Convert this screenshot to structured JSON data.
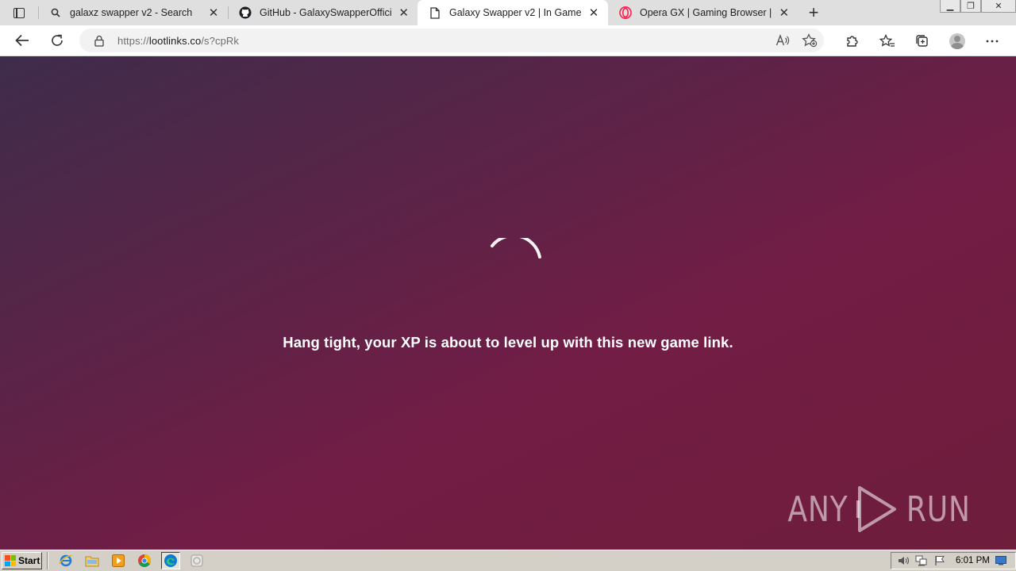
{
  "browser": {
    "tabs": [
      {
        "title": "galaxz swapper v2 - Search",
        "icon": "search-icon",
        "active": false
      },
      {
        "title": "GitHub - GalaxySwapperOfficial/",
        "icon": "github-icon",
        "active": false
      },
      {
        "title": "Galaxy Swapper v2 | In Game",
        "icon": "page-icon",
        "active": true
      },
      {
        "title": "Opera GX | Gaming Browser | Op",
        "icon": "opera-icon",
        "active": false
      }
    ],
    "address": {
      "scheme": "https://",
      "host": "lootlinks.co",
      "path": "/s?cpRk"
    }
  },
  "page": {
    "message": "Hang tight, your XP is about to level up with this new game link.",
    "watermark_left": "ANY",
    "watermark_right": "RUN",
    "colors": {
      "gradient_start": "#3e2c4b",
      "gradient_mid": "#721d45",
      "gradient_end": "#6e1d3b",
      "text": "#ffffff"
    }
  },
  "taskbar": {
    "start_label": "Start",
    "clock": "6:01 PM"
  }
}
